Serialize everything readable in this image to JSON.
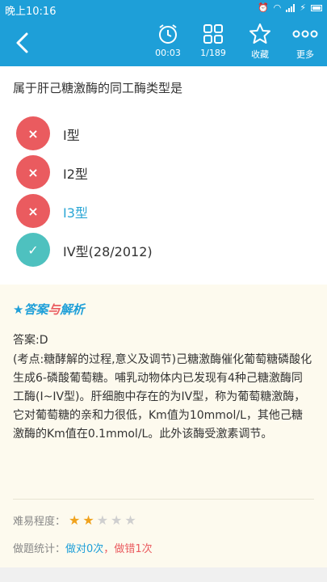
{
  "status_bar": {
    "time": "晚上10:16"
  },
  "toolbar": {
    "timer": "00:03",
    "progress": "1/189",
    "favorite_label": "收藏",
    "more_label": "更多"
  },
  "question": "属于肝己糖激酶的同工酶类型是",
  "options": [
    {
      "label": "I型",
      "state": "wrong",
      "mark": "×"
    },
    {
      "label": "I2型",
      "state": "wrong",
      "mark": "×"
    },
    {
      "label": "I3型",
      "state": "wrong-selected",
      "mark": "×"
    },
    {
      "label": "IV型(28/2012)",
      "state": "correct",
      "mark": "✓"
    }
  ],
  "analysis": {
    "heading_star": "★",
    "heading_a": "答案",
    "heading_b": "与",
    "heading_c": "解析",
    "answer": "答案:D",
    "explanation": "(考点:糖酵解的过程,意义及调节)己糖激酶催化葡萄糖磷酸化生成6-磷酸葡萄糖。哺乳动物体内已发现有4种己糖激酶同工酶(I~IV型)。肝细胞中存在的为IV型，称为葡萄糖激酶，它对葡萄糖的亲和力很低，Km值为10mmol/L，其他己糖激酶的Km值在0.1mmol/L。此外该酶受激素调节。",
    "difficulty_label": "难易程度：",
    "difficulty_rating": 2,
    "difficulty_max": 5,
    "stats_label": "做题统计：",
    "stats_correct": "做对0次",
    "stats_sep": "，",
    "stats_wrong": "做错1次"
  },
  "colors": {
    "primary": "#1e9fd8",
    "wrong": "#ea5b5f",
    "correct": "#4ec1bf",
    "star": "#f0a21d"
  }
}
